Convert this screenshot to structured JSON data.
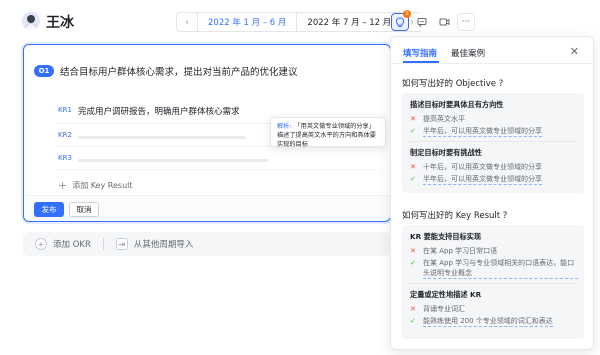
{
  "header": {
    "user_name": "王冰",
    "period_prev": "‹",
    "period_next": "›",
    "periods": [
      {
        "label": "2022 年 1 月 – 6 月",
        "active": true
      },
      {
        "label": "2022 年 7 月 – 12 月",
        "active": false
      }
    ],
    "tools": [
      {
        "icon": "lightbulb-icon",
        "badge": "1",
        "active": true
      },
      {
        "icon": "comment-icon",
        "active": false
      },
      {
        "icon": "video-icon",
        "active": false
      },
      {
        "icon": "more-icon",
        "active": false
      }
    ],
    "more_glyph": "···"
  },
  "objective": {
    "badge": "O1",
    "title": "结合目标用户群体核心需求，提出对当前产品的优化建议",
    "key_results": [
      {
        "label": "KR1",
        "text": "完成用户调研报告，明确用户群体核心需求"
      },
      {
        "label": "KR2",
        "text": ""
      },
      {
        "label": "KR3",
        "text": ""
      }
    ],
    "add_kr_label": "添加 Key Result",
    "publish_label": "发布",
    "cancel_label": "取消"
  },
  "tooltip": {
    "key": "解析:",
    "text": "「用英文做专业领域的分享」描述了提高英文水平的方向和具体要实现的目标"
  },
  "bottom_actions": {
    "add_okr_label": "添加 OKR",
    "import_label": "从其他周期导入"
  },
  "guide": {
    "tabs": [
      "填写指南",
      "最佳案例"
    ],
    "close_glyph": "✕",
    "objective_section": {
      "title": "如何写出好的 Objective ?",
      "groups": [
        {
          "subtitle": "描述目标时要具体且有方向性",
          "items": [
            {
              "type": "bad",
              "mark": "✕",
              "text": "提高英文水平"
            },
            {
              "type": "good",
              "mark": "✓",
              "text": "半年后，可以用英文做专业领域的分享"
            }
          ]
        },
        {
          "subtitle": "制定目标时要有挑战性",
          "items": [
            {
              "type": "bad",
              "mark": "✕",
              "text": "十年后，可以用英文做专业领域的分享"
            },
            {
              "type": "good",
              "mark": "✓",
              "text": "半年后，可以用英文做专业领域的分享"
            }
          ]
        }
      ]
    },
    "kr_section": {
      "title": "如何写出好的 Key Result ?",
      "groups": [
        {
          "subtitle": "KR 要能支持目标实现",
          "items": [
            {
              "type": "bad",
              "mark": "✕",
              "text": "在某 App 学习日常口语"
            },
            {
              "type": "good",
              "mark": "✓",
              "text": "在某 App 学习与专业领域相关的口语表达，能口头说明专业概念"
            }
          ]
        },
        {
          "subtitle": "定量或定性地描述 KR",
          "items": [
            {
              "type": "bad",
              "mark": "✕",
              "text": "背诵专业词汇"
            },
            {
              "type": "good",
              "mark": "✓",
              "text": "能熟练使用 200 个专业领域的词汇和表达"
            }
          ]
        }
      ]
    }
  },
  "colors": {
    "accent": "#3370ff",
    "bad": "#f54a45",
    "good": "#34c724",
    "badge": "#f7780f"
  }
}
